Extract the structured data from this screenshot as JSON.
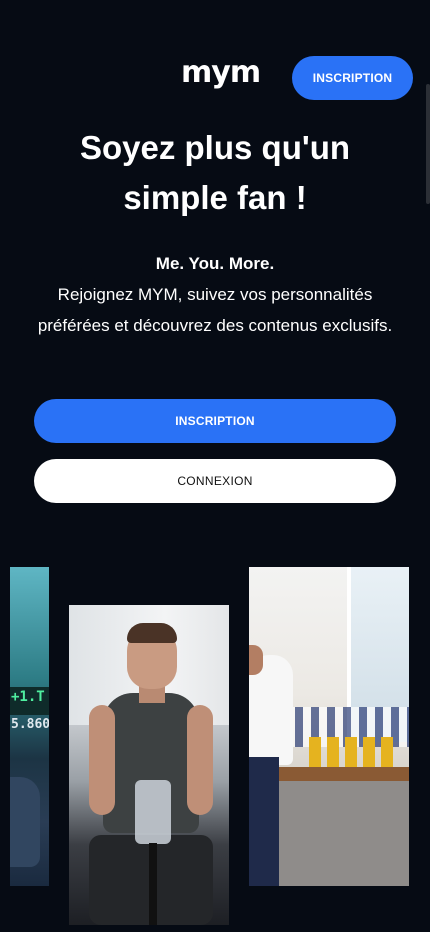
{
  "header": {
    "logo": "mym",
    "signup_label": "INSCRIPTION"
  },
  "hero": {
    "title": "Soyez plus qu'un simple fan !",
    "tagline": "Me. You. More.",
    "description": "Rejoignez MYM, suivez vos personnalités préférées et découvrez des contenus exclusifs."
  },
  "actions": {
    "signup_label": "INSCRIPTION",
    "login_label": "CONNEXION"
  },
  "colors": {
    "background": "#060b14",
    "accent": "#2a72f6"
  },
  "gallery": {
    "cards": [
      {
        "id": "stock-ticker"
      },
      {
        "id": "fitness-creator"
      },
      {
        "id": "kitchen-cooking"
      }
    ],
    "left_card_text": [
      "+1.T",
      "5.860"
    ]
  }
}
